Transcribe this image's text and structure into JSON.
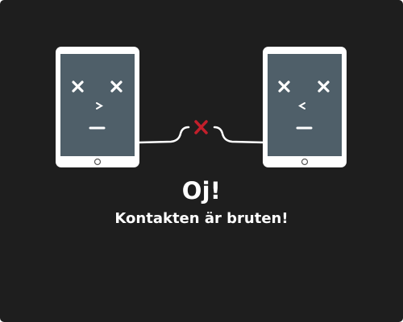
{
  "dialog": {
    "title": "Oj!",
    "message": "Kontakten är bruten!"
  },
  "illustration": {
    "left_tablet_icon": "sad-tablet-icon",
    "right_tablet_icon": "sad-tablet-icon",
    "connection_icon": "disconnected-x-icon",
    "colors": {
      "background": "#1e1e1e",
      "tablet_body": "#ffffff",
      "tablet_screen": "#4f5f69",
      "cable": "#ffffff",
      "broken_mark": "#c21f2b"
    }
  }
}
